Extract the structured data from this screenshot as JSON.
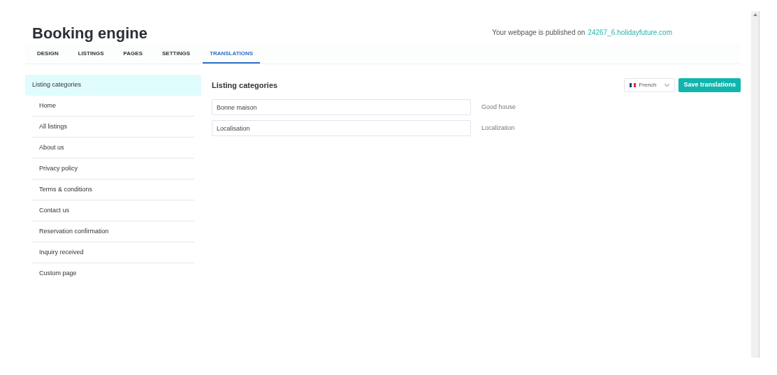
{
  "header": {
    "title": "Booking engine",
    "published_text": "Your webpage is published on",
    "published_link": "24267_6.holidayfuture.com"
  },
  "tabs": [
    {
      "label": "DESIGN",
      "selected": false
    },
    {
      "label": "LISTINGS",
      "selected": false
    },
    {
      "label": "PAGES",
      "selected": false
    },
    {
      "label": "SETTINGS",
      "selected": false
    },
    {
      "label": "TRANSLATIONS",
      "selected": true
    }
  ],
  "sidebar": {
    "items": [
      {
        "label": "Listing categories",
        "selected": true
      },
      {
        "label": "Home",
        "selected": false
      },
      {
        "label": "All listings",
        "selected": false
      },
      {
        "label": "About us",
        "selected": false
      },
      {
        "label": "Privacy policy",
        "selected": false
      },
      {
        "label": "Terms & conditions",
        "selected": false
      },
      {
        "label": "Contact us",
        "selected": false
      },
      {
        "label": "Reservation confirmation",
        "selected": false
      },
      {
        "label": "Inquiry received",
        "selected": false
      },
      {
        "label": "Custom page",
        "selected": false
      }
    ]
  },
  "panel": {
    "title": "Listing categories",
    "language": "French",
    "save_button": "Save translations",
    "rows": [
      {
        "value": "Bonne maison",
        "original": "Good house"
      },
      {
        "value": "Localisation",
        "original": "Localization"
      }
    ]
  }
}
